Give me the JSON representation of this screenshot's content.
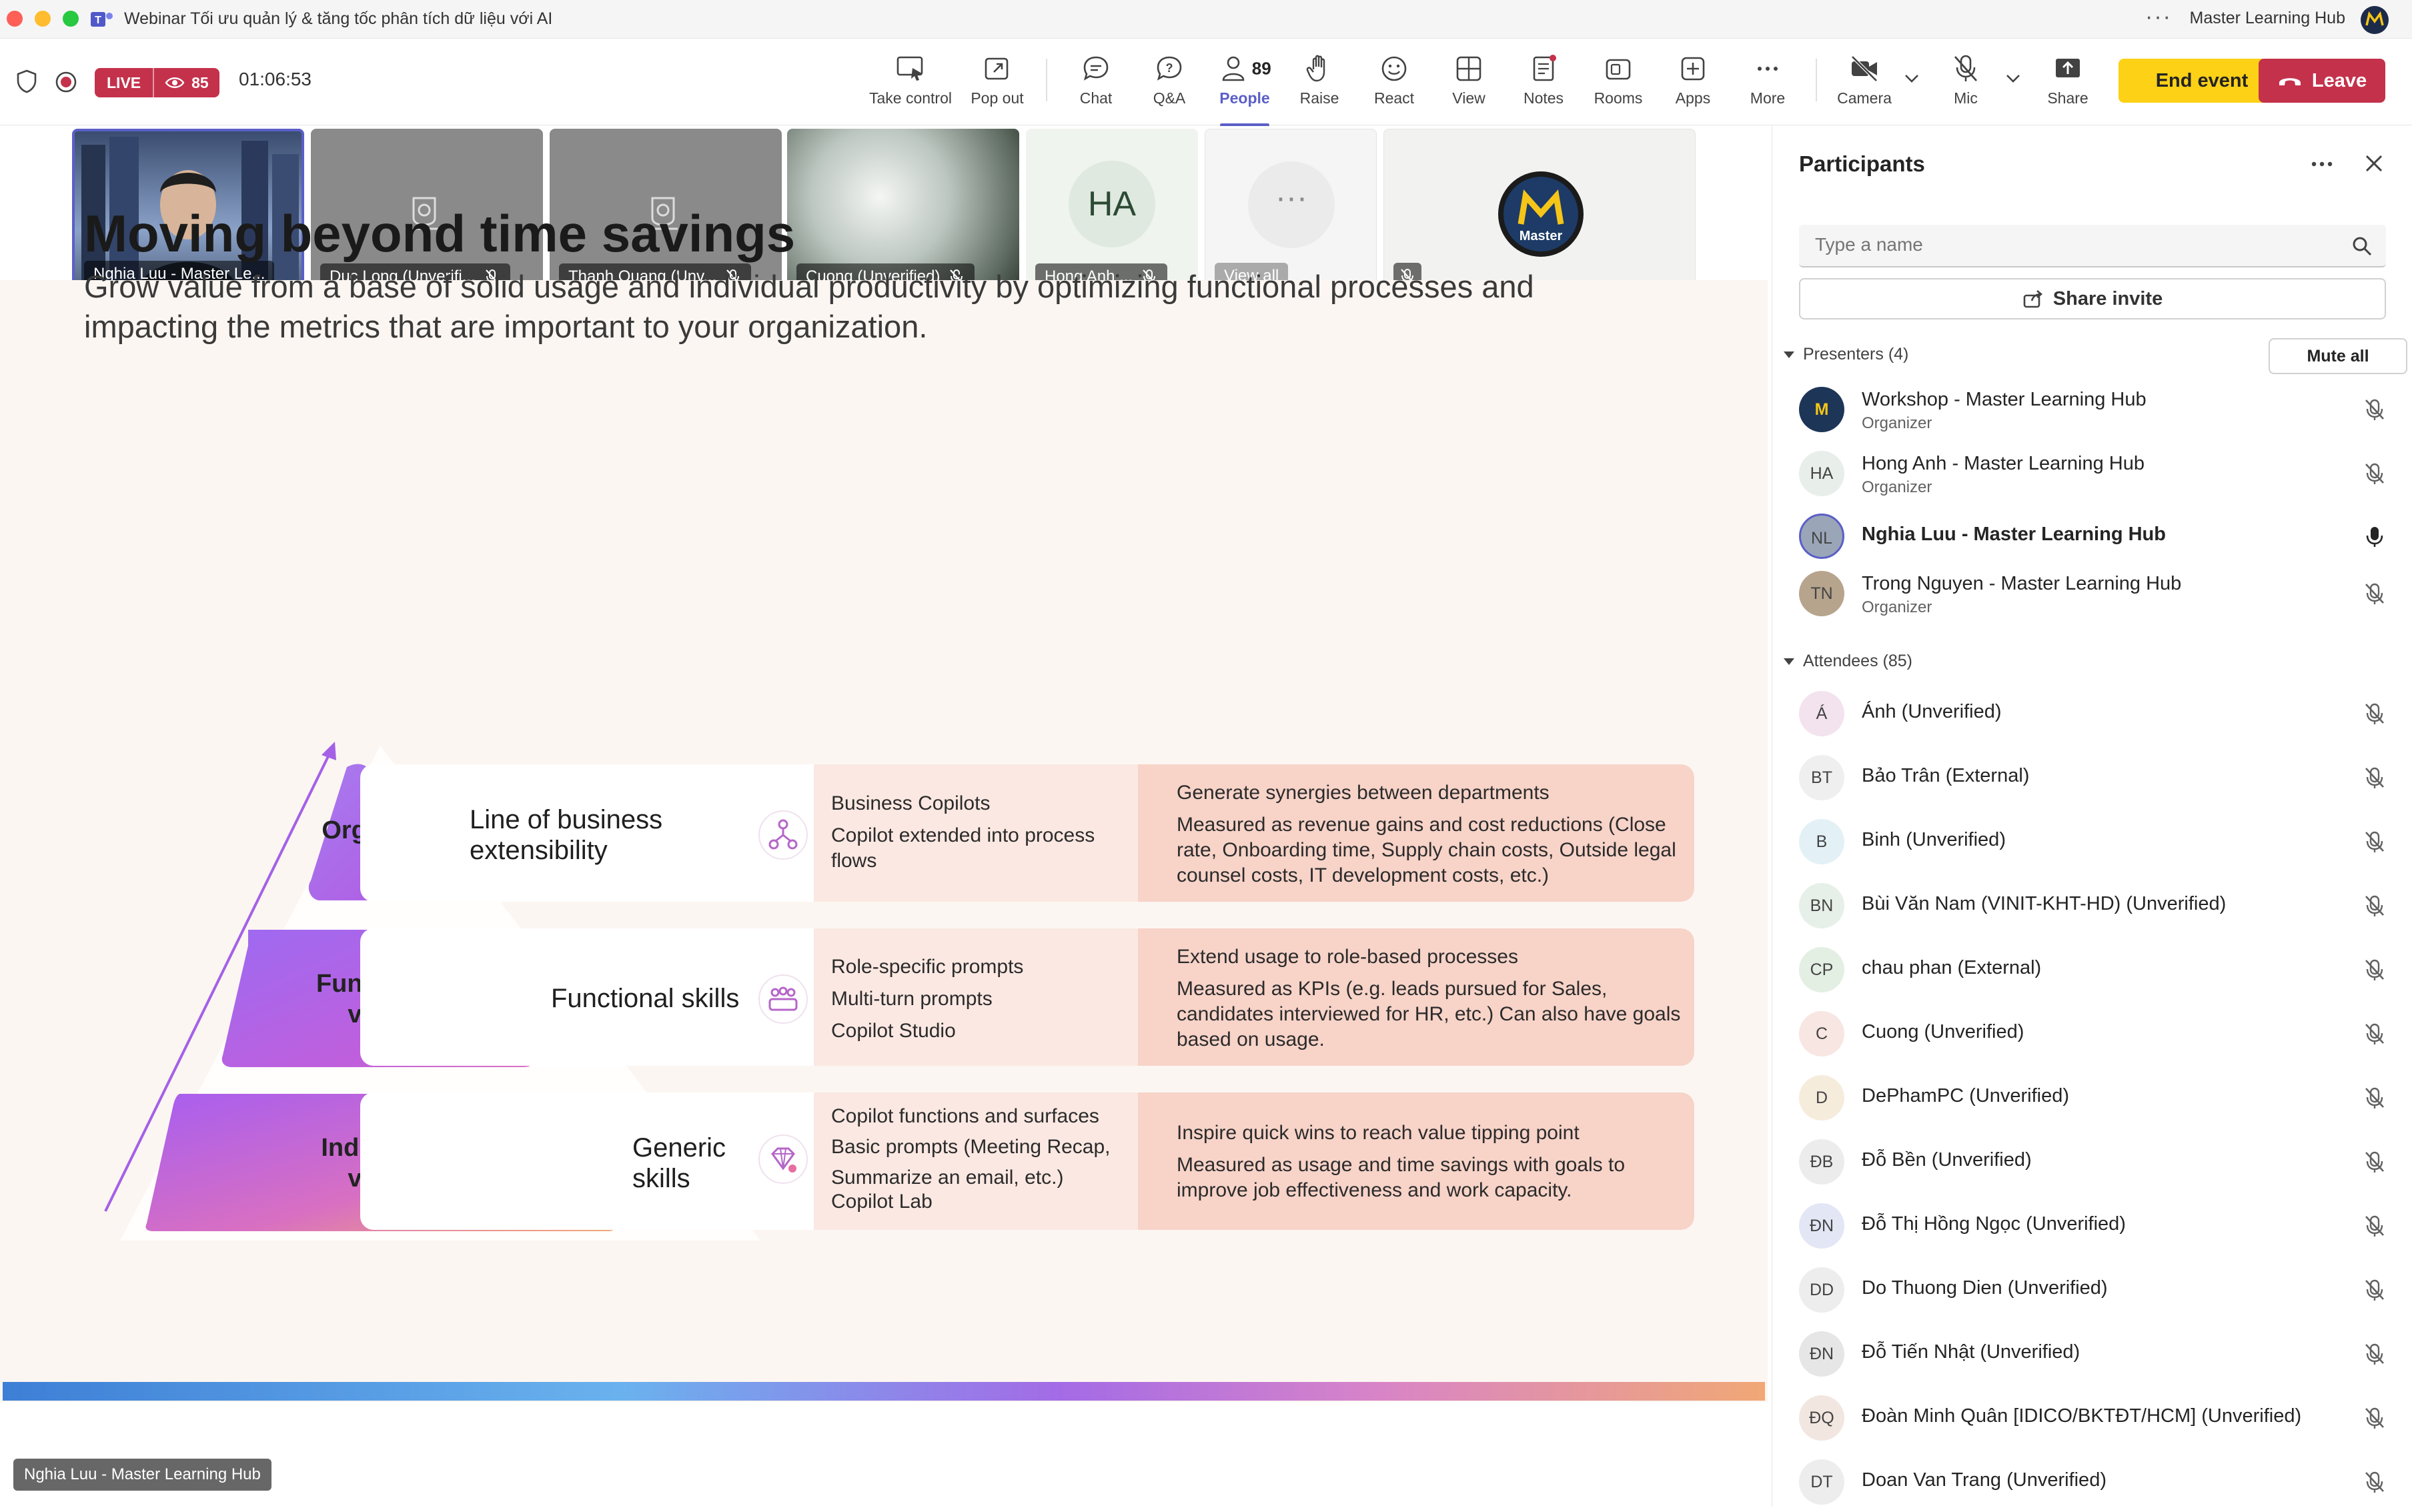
{
  "window": {
    "title": "Webinar Tối ưu quản lý & tăng tốc phân tích dữ liệu với AI",
    "org_name": "Master Learning Hub",
    "more_glyph": "···"
  },
  "status": {
    "live_label": "LIVE",
    "viewer_count": "85",
    "elapsed": "01:06:53"
  },
  "toolbar": {
    "take_control": "Take control",
    "pop_out": "Pop out",
    "chat": "Chat",
    "qa": "Q&A",
    "people": "People",
    "people_count": "89",
    "raise": "Raise",
    "react": "React",
    "view": "View",
    "notes": "Notes",
    "rooms": "Rooms",
    "apps": "Apps",
    "more": "More",
    "camera": "Camera",
    "mic": "Mic",
    "share": "Share",
    "end_event": "End event",
    "leave": "Leave"
  },
  "gallery": {
    "tiles": [
      {
        "name": "Nghia Luu - Master Le..."
      },
      {
        "name": "Duc Long (Unverifi..."
      },
      {
        "name": "Thanh Quang (Unv..."
      },
      {
        "name": "Cuong (Unverified)"
      },
      {
        "name": "Hong Anh ...",
        "initials": "HA"
      },
      {
        "name": "View all"
      },
      {
        "name": ""
      }
    ],
    "logo_text": "Master"
  },
  "slide": {
    "title": "Moving beyond time savings",
    "subtitle": "Grow value from a base of solid usage and individual productivity by optimizing functional processes and impacting the metrics that are important to your organization.",
    "levels": [
      {
        "pyramid_label": "Org value",
        "skill": "Line of business extensibility",
        "features": [
          "Business Copilots",
          "Copilot extended into process flows"
        ],
        "outcome_head": "Generate synergies between departments",
        "outcome_body": "Measured as revenue gains and cost reductions (Close rate, Onboarding time, Supply chain costs, Outside legal counsel costs, IT development costs, etc.)"
      },
      {
        "pyramid_label": "Functional value",
        "skill": "Functional skills",
        "features": [
          "Role-specific prompts",
          "Multi-turn prompts",
          "Copilot Studio"
        ],
        "outcome_head": "Extend usage to role-based processes",
        "outcome_body": "Measured as KPIs (e.g. leads pursued for Sales, candidates interviewed for HR, etc.) Can also have goals based on usage."
      },
      {
        "pyramid_label": "Individual value",
        "skill": "Generic skills",
        "features": [
          "Copilot functions and surfaces",
          "Basic prompts (Meeting Recap,",
          "Summarize an email, etc.)",
          "Copilot Lab"
        ],
        "outcome_head": "Inspire quick wins to reach value tipping point",
        "outcome_body": "Measured as usage and time savings with goals to improve job effectiveness and work capacity."
      }
    ]
  },
  "speaker_tag": "Nghia Luu - Master Learning Hub",
  "panel": {
    "title": "Participants",
    "search_placeholder": "Type a name",
    "share_invite": "Share invite",
    "mute_all": "Mute all",
    "presenters_label": "Presenters (4)",
    "attendees_label": "Attendees (85)",
    "presenters": [
      {
        "name": "Workshop - Master Learning Hub",
        "role": "Organizer",
        "initials": "M",
        "avatar_color": "#1d3557"
      },
      {
        "name": "Hong Anh - Master Learning Hub",
        "role": "Organizer",
        "initials": "HA",
        "avatar_color": "#e8eeea"
      },
      {
        "name": "Nghia Luu - Master Learning Hub",
        "role": "",
        "initials": "NL",
        "avatar_color": "#9aa6b8"
      },
      {
        "name": "Trong Nguyen - Master Learning Hub",
        "role": "Organizer",
        "initials": "TN",
        "avatar_color": "#b7a48d"
      }
    ],
    "attendees": [
      {
        "name": "Ánh (Unverified)",
        "initials": "Á",
        "avatar_color": "#f3e3ee"
      },
      {
        "name": "Bảo Trân (External)",
        "initials": "BT",
        "avatar_color": "#efefef"
      },
      {
        "name": "Binh (Unverified)",
        "initials": "B",
        "avatar_color": "#e3f1f6"
      },
      {
        "name": "Bùi Văn Nam (VINIT-KHT-HD) (Unverified)",
        "initials": "BN",
        "avatar_color": "#e6f0e8"
      },
      {
        "name": "chau phan (External)",
        "initials": "CP",
        "avatar_color": "#e4efe4"
      },
      {
        "name": "Cuong (Unverified)",
        "initials": "C",
        "avatar_color": "#f8e6e2"
      },
      {
        "name": "DePhamPC (Unverified)",
        "initials": "D",
        "avatar_color": "#f6ecdc"
      },
      {
        "name": "Đỗ Bền (Unverified)",
        "initials": "ĐB",
        "avatar_color": "#ececec"
      },
      {
        "name": "Đỗ Thị Hồng Ngọc (Unverified)",
        "initials": "ĐN",
        "avatar_color": "#e3e6f5"
      },
      {
        "name": "Do Thuong Dien (Unverified)",
        "initials": "DD",
        "avatar_color": "#ededed"
      },
      {
        "name": "Đỗ Tiến Nhật (Unverified)",
        "initials": "ĐN",
        "avatar_color": "#e6e6e6"
      },
      {
        "name": "Đoàn Minh Quân [IDICO/BKTĐT/HCM] (Unverified)",
        "initials": "ĐQ",
        "avatar_color": "#f2e6e0"
      },
      {
        "name": "Doan Van Trang (Unverified)",
        "initials": "DT",
        "avatar_color": "#ededed"
      }
    ]
  },
  "colors": {
    "accent": "#5b5fc7",
    "live_red": "#c4314b",
    "end_yellow": "#fcd116",
    "slide_bg": "#fcf6f2"
  }
}
